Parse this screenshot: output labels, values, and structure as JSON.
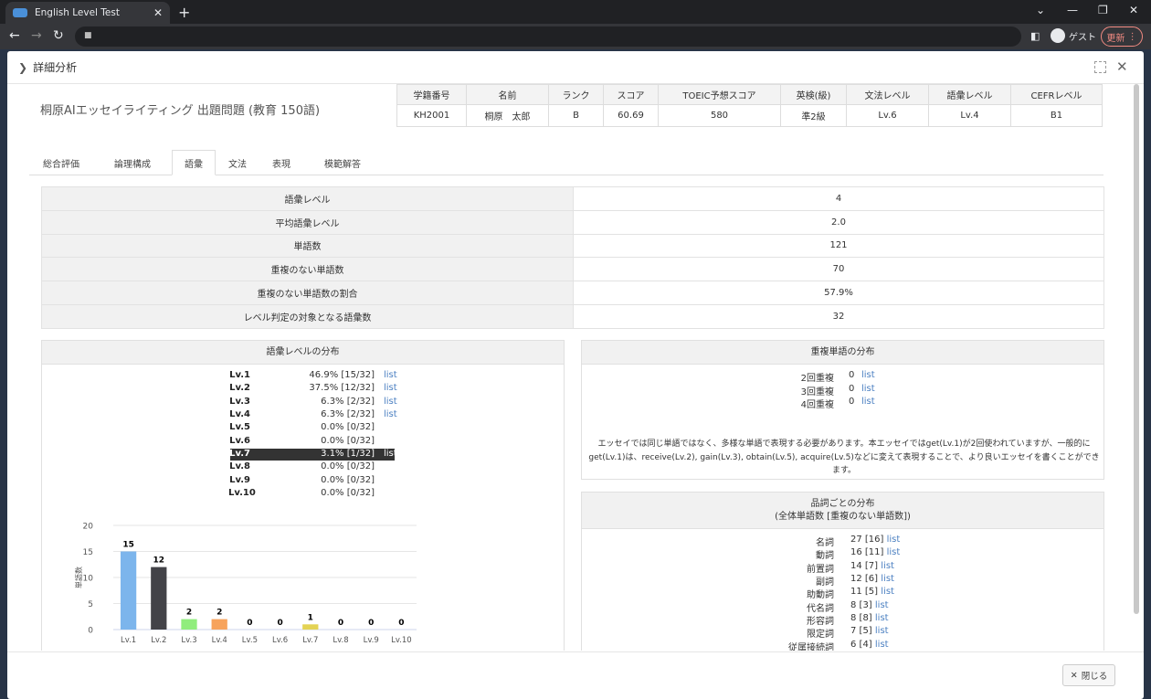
{
  "browser": {
    "tab_title": "English Level Test",
    "guest_label": "ゲスト",
    "update_label": "更新"
  },
  "modal": {
    "title": "詳細分析",
    "close_label": "閉じる"
  },
  "question_title": "桐原AIエッセイライティング 出題問題 (教育 150語)",
  "student": {
    "headers": [
      "学籍番号",
      "名前",
      "ランク",
      "スコア",
      "TOEIC予想スコア",
      "英検(級)",
      "文法レベル",
      "語彙レベル",
      "CEFRレベル"
    ],
    "values": [
      "KH2001",
      "桐原　太郎",
      "B",
      "60.69",
      "580",
      "準2級",
      "Lv.6",
      "Lv.4",
      "B1"
    ]
  },
  "tabs": [
    "総合評価",
    "論理構成",
    "語彙",
    "文法",
    "表現",
    "模範解答"
  ],
  "active_tab": "語彙",
  "vocab_summary": [
    {
      "label": "語彙レベル",
      "value": "4"
    },
    {
      "label": "平均語彙レベル",
      "value": "2.0"
    },
    {
      "label": "単語数",
      "value": "121"
    },
    {
      "label": "重複のない単語数",
      "value": "70"
    },
    {
      "label": "重複のない単語数の割合",
      "value": "57.9%"
    },
    {
      "label": "レベル判定の対象となる語彙数",
      "value": "32"
    }
  ],
  "level_distribution": {
    "title": "語彙レベルの分布",
    "list_label": "list",
    "rows": [
      {
        "level": "Lv.1",
        "value": "46.9% [15/32]",
        "has_list": true
      },
      {
        "level": "Lv.2",
        "value": "37.5% [12/32]",
        "has_list": true
      },
      {
        "level": "Lv.3",
        "value": "6.3% [2/32]",
        "has_list": true
      },
      {
        "level": "Lv.4",
        "value": "6.3% [2/32]",
        "has_list": true
      },
      {
        "level": "Lv.5",
        "value": "0.0% [0/32]",
        "has_list": false
      },
      {
        "level": "Lv.6",
        "value": "0.0% [0/32]",
        "has_list": false
      },
      {
        "level": "Lv.7",
        "value": "3.1% [1/32]",
        "has_list": true,
        "selected": true
      },
      {
        "level": "Lv.8",
        "value": "0.0% [0/32]",
        "has_list": false
      },
      {
        "level": "Lv.9",
        "value": "0.0% [0/32]",
        "has_list": false
      },
      {
        "level": "Lv.10",
        "value": "0.0% [0/32]",
        "has_list": false
      }
    ]
  },
  "chart_data": {
    "type": "bar",
    "categories": [
      "Lv.1",
      "Lv.2",
      "Lv.3",
      "Lv.4",
      "Lv.5",
      "Lv.6",
      "Lv.7",
      "Lv.8",
      "Lv.9",
      "Lv.10"
    ],
    "values": [
      15,
      12,
      2,
      2,
      0,
      0,
      1,
      0,
      0,
      0
    ],
    "colors": [
      "#7cb5ec",
      "#434348",
      "#90ed7d",
      "#f7a35c",
      "#8085e9",
      "#f15c80",
      "#e4d354",
      "#2b908f",
      "#f45b5b",
      "#91e8e1"
    ],
    "ylabel": "単語数",
    "xlabel": "",
    "ylim": [
      0,
      20
    ],
    "yticks": [
      0,
      5,
      10,
      15,
      20
    ],
    "grid": true
  },
  "duplicate_distribution": {
    "title": "重複単語の分布",
    "list_label": "list",
    "rows": [
      {
        "label": "2回重複",
        "value": "0"
      },
      {
        "label": "3回重複",
        "value": "0"
      },
      {
        "label": "4回重複",
        "value": "0"
      }
    ],
    "note": "エッセイでは同じ単語ではなく、多様な単語で表現する必要があります。本エッセイではget(Lv.1)が2回使われていますが、一般的にget(Lv.1)は、receive(Lv.2), gain(Lv.3), obtain(Lv.5), acquire(Lv.5)などに変えて表現することで、より良いエッセイを書くことができます。"
  },
  "pos_distribution": {
    "title": "品詞ごとの分布",
    "subtitle": "(全体単語数 [重複のない単語数])",
    "list_label": "list",
    "rows": [
      {
        "label": "名詞",
        "value": "27 [16]"
      },
      {
        "label": "動詞",
        "value": "16 [11]"
      },
      {
        "label": "前置詞",
        "value": "14 [7]"
      },
      {
        "label": "副詞",
        "value": "12 [6]"
      },
      {
        "label": "助動詞",
        "value": "11 [5]"
      },
      {
        "label": "代名詞",
        "value": "8 [3]"
      },
      {
        "label": "形容詞",
        "value": "8 [8]"
      },
      {
        "label": "限定詞",
        "value": "7 [5]"
      },
      {
        "label": "従属接続詞",
        "value": "6 [4]"
      }
    ]
  }
}
